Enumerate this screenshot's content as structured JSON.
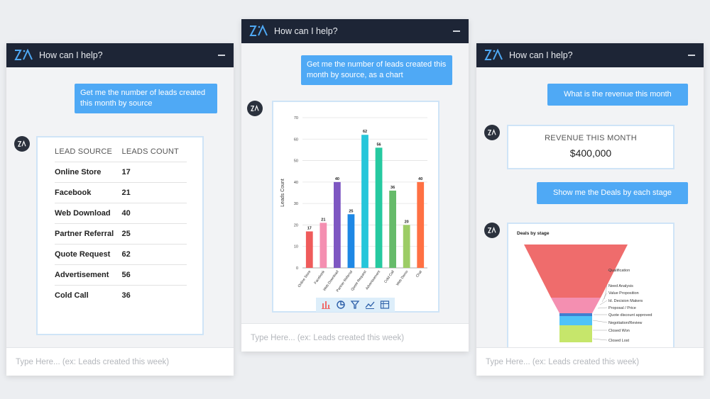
{
  "header_title": "How can I help?",
  "input_placeholder": "Type Here... (ex: Leads created this week)",
  "left": {
    "user_message": "Get me the number of leads created this month by source",
    "table": {
      "headers": [
        "LEAD SOURCE",
        "LEADS COUNT"
      ],
      "rows": [
        [
          "Online Store",
          "17"
        ],
        [
          "Facebook",
          "21"
        ],
        [
          "Web Download",
          "40"
        ],
        [
          "Partner Referral",
          "25"
        ],
        [
          "Quote Request",
          "62"
        ],
        [
          "Advertisement",
          "56"
        ],
        [
          "Cold Call",
          "36"
        ]
      ]
    }
  },
  "middle": {
    "user_message": "Get me the number of leads created this month by source, as a chart",
    "toolbar_icons": [
      "bar-chart-icon",
      "pie-chart-icon",
      "funnel-icon",
      "line-chart-icon",
      "table-icon"
    ]
  },
  "right": {
    "user_message_1": "What is the revenue this month",
    "revenue_title": "REVENUE THIS MONTH",
    "revenue_value": "$400,000",
    "user_message_2": "Show me the Deals by each stage"
  },
  "chart_data": [
    {
      "type": "bar",
      "categories": [
        "Online Store",
        "Facebook",
        "Web Download",
        "Partner Referral",
        "Quote Request",
        "Advertisement",
        "Cold Call",
        "Web Demo",
        "Chat"
      ],
      "values": [
        17,
        21,
        40,
        25,
        62,
        56,
        36,
        20,
        40
      ],
      "colors": [
        "#ef5b5b",
        "#f48fb1",
        "#7e57c2",
        "#1e88e5",
        "#26c6da",
        "#26c9a0",
        "#66bb6a",
        "#9ccc65",
        "#ff7043"
      ],
      "ylabel": "Leads Count",
      "xlabel": "",
      "ylim": [
        0,
        70
      ],
      "yticks": [
        0,
        10,
        20,
        30,
        40,
        50,
        60,
        70
      ],
      "grid": true
    },
    {
      "type": "funnel",
      "title": "Deals by stage",
      "stages": [
        "Qualification",
        "Need Analysis",
        "Value Proposition",
        "Id. Decision Makers",
        "Proposal / Price",
        "Quote discount approved",
        "Negotiation/Review",
        "Closed Won",
        "Closed Lost"
      ],
      "colors": [
        "#ef6c6c",
        "#ef6c6c",
        "#f48fb1",
        "#f48fb1",
        "#f48fb1",
        "#3f7fd1",
        "#4fc3f7",
        "#9ccc65",
        "#c6e66b"
      ]
    }
  ]
}
